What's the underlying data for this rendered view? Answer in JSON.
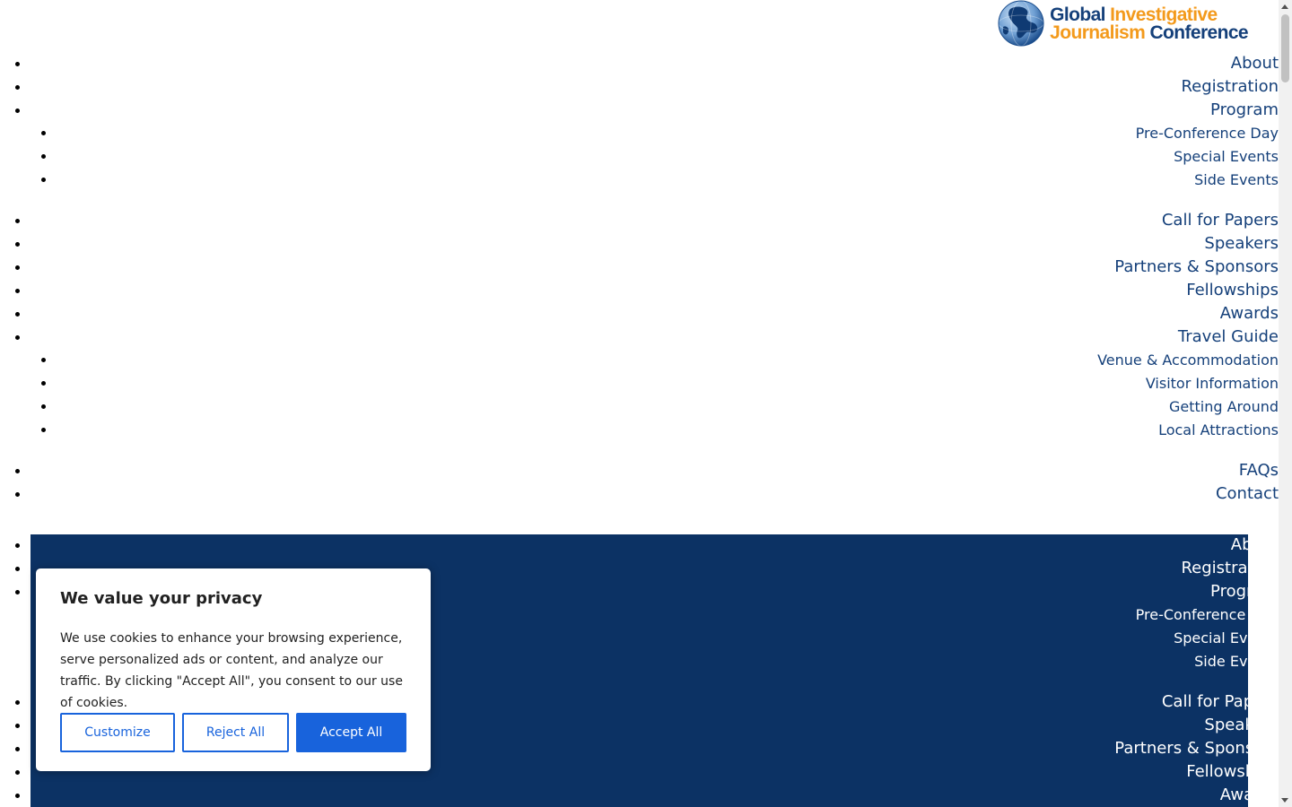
{
  "brand": {
    "logo_line1_word1": "Global",
    "logo_line1_word2": "Investigative",
    "logo_line2_word1": "Journalism",
    "logo_line2_word2": "Conference"
  },
  "nav": {
    "about": "About",
    "registration": "Registration",
    "program": "Program",
    "program_sub": {
      "pre_conference_day": "Pre-Conference Day",
      "special_events": "Special Events",
      "side_events": "Side Events"
    },
    "call_for_papers": "Call for Papers",
    "speakers": "Speakers",
    "partners_sponsors": "Partners & Sponsors",
    "fellowships": "Fellowships",
    "awards": "Awards",
    "travel_guide": "Travel Guide",
    "travel_sub": {
      "venue_accommodation": "Venue & Accommodation",
      "visitor_information": "Visitor Information",
      "getting_around": "Getting Around",
      "local_attractions": "Local Attractions"
    },
    "faqs": "FAQs",
    "contact": "Contact"
  },
  "cookie_banner": {
    "title": "We value your privacy",
    "body": "We use cookies to enhance your browsing experience, serve personalized ads or content, and analyze our traffic. By clicking \"Accept All\", you consent to our use of cookies.",
    "customize_label": "Customize",
    "reject_label": "Reject All",
    "accept_label": "Accept All"
  },
  "colors": {
    "nav_link": "#15407a",
    "dark_nav_background": "#0c3264",
    "logo_orange": "#f39a1c",
    "cookie_accent": "#1863dc"
  },
  "icons": {
    "logo": "globe-icon",
    "scroll_up": "scroll-up-arrow-icon",
    "scroll_down": "scroll-down-arrow-icon"
  }
}
